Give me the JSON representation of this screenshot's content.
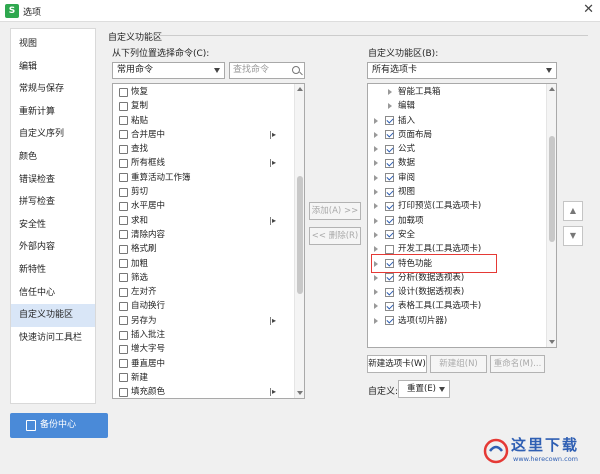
{
  "window": {
    "icon_text": "S",
    "title": "选项",
    "close_glyph": "✕"
  },
  "sidebar": {
    "items": [
      {
        "label": "视图"
      },
      {
        "label": "编辑"
      },
      {
        "label": "常规与保存"
      },
      {
        "label": "重新计算"
      },
      {
        "label": "自定义序列"
      },
      {
        "label": "颜色"
      },
      {
        "label": "错误检查"
      },
      {
        "label": "拼写检查"
      },
      {
        "label": "安全性"
      },
      {
        "label": "外部内容"
      },
      {
        "label": "新特性"
      },
      {
        "label": "信任中心"
      },
      {
        "label": "自定义功能区"
      },
      {
        "label": "快速访问工具栏"
      }
    ],
    "active_index": 12,
    "backup_label": "备份中心"
  },
  "section": {
    "title": "自定义功能区"
  },
  "left_panel": {
    "label": "从下列位置选择命令(C):",
    "dropdown_value": "常用命令",
    "search_placeholder": "查找命令",
    "commands": [
      {
        "label": "恢复",
        "icon": "redo-icon"
      },
      {
        "label": "复制",
        "icon": "copy-icon"
      },
      {
        "label": "粘贴",
        "icon": "paste-icon"
      },
      {
        "label": "合并居中",
        "icon": "merge-center-icon",
        "more": "|▸"
      },
      {
        "label": "查找",
        "icon": "find-icon"
      },
      {
        "label": "所有框线",
        "icon": "all-borders-icon",
        "more": "|▸"
      },
      {
        "label": "重算活动工作簿",
        "icon": "recalc-icon"
      },
      {
        "label": "剪切",
        "icon": "cut-icon"
      },
      {
        "label": "水平居中",
        "icon": "align-center-icon"
      },
      {
        "label": "求和",
        "icon": "sum-icon",
        "more": "|▸"
      },
      {
        "label": "清除内容",
        "icon": "clear-icon"
      },
      {
        "label": "格式刷",
        "icon": "format-painter-icon"
      },
      {
        "label": "加粗",
        "icon": "bold-icon"
      },
      {
        "label": "筛选",
        "icon": "filter-icon"
      },
      {
        "label": "左对齐",
        "icon": "align-left-icon"
      },
      {
        "label": "自动换行",
        "icon": "wrap-text-icon"
      },
      {
        "label": "另存为",
        "icon": "save-as-icon",
        "more": "|▸"
      },
      {
        "label": "插入批注",
        "icon": "comment-icon"
      },
      {
        "label": "增大字号",
        "icon": "font-grow-icon"
      },
      {
        "label": "垂直居中",
        "icon": "valign-center-icon"
      },
      {
        "label": "新建",
        "icon": "new-icon"
      },
      {
        "label": "填充颜色",
        "icon": "fill-color-icon",
        "more": "|▸"
      }
    ]
  },
  "mid_buttons": {
    "add": "添加(A) >>",
    "remove": "<< 删除(R)"
  },
  "right_panel": {
    "label": "自定义功能区(B):",
    "dropdown_value": "所有选项卡",
    "tabs": [
      {
        "label": "智能工具箱",
        "indent": 1,
        "checked": null
      },
      {
        "label": "编辑",
        "indent": 1,
        "checked": null
      },
      {
        "label": "插入",
        "indent": 0,
        "checked": true
      },
      {
        "label": "页面布局",
        "indent": 0,
        "checked": true
      },
      {
        "label": "公式",
        "indent": 0,
        "checked": true
      },
      {
        "label": "数据",
        "indent": 0,
        "checked": true
      },
      {
        "label": "审阅",
        "indent": 0,
        "checked": true
      },
      {
        "label": "视图",
        "indent": 0,
        "checked": true
      },
      {
        "label": "打印预览(工具选项卡)",
        "indent": 0,
        "checked": true
      },
      {
        "label": "加载项",
        "indent": 0,
        "checked": true
      },
      {
        "label": "安全",
        "indent": 0,
        "checked": true
      },
      {
        "label": "开发工具(工具选项卡)",
        "indent": 0,
        "checked": false
      },
      {
        "label": "特色功能",
        "indent": 0,
        "checked": true
      },
      {
        "label": "分析(数据透视表)",
        "indent": 0,
        "checked": true
      },
      {
        "label": "设计(数据透视表)",
        "indent": 0,
        "checked": true
      },
      {
        "label": "表格工具(工具选项卡)",
        "indent": 0,
        "checked": true
      },
      {
        "label": "选项(切片器)",
        "indent": 0,
        "checked": true
      }
    ],
    "new_tab": "新建选项卡(W)",
    "new_group": "新建组(N)",
    "rename": "重命名(M)...",
    "customize_label": "自定义:",
    "reset": "重置(E)"
  },
  "move": {
    "up_glyph": "▲",
    "down_glyph": "▼"
  },
  "watermark": {
    "title": "这里下载",
    "url": "www.herecown.com"
  }
}
